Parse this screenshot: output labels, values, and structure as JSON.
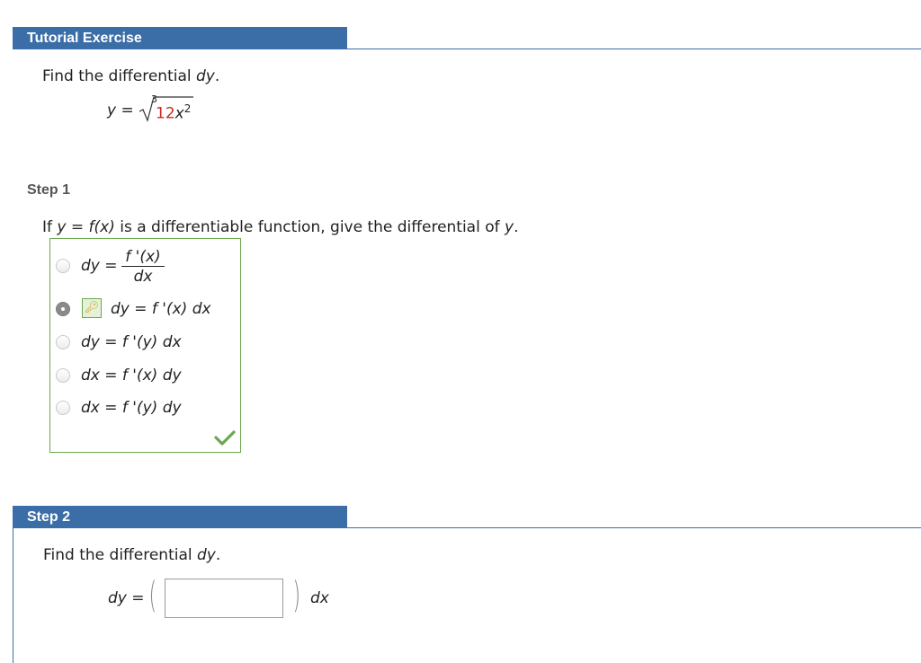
{
  "header": {
    "title": "Tutorial Exercise"
  },
  "problem": {
    "prompt_text": "Find the differential ",
    "prompt_var": "dy",
    "prompt_end": ".",
    "eq_lhs": "y =",
    "root_index": "3",
    "radicand_coef": "12",
    "radicand_var": "x",
    "radicand_exp": "2"
  },
  "step1": {
    "label": "Step 1",
    "question_pre": "If ",
    "question_eq": "y = f(x)",
    "question_mid": " is a differentiable function, give the differential of ",
    "question_var": "y",
    "question_end": ".",
    "options": [
      {
        "lhs": "dy =",
        "numerator": "f '(x)",
        "denominator": "dx",
        "selected": false
      },
      {
        "text": "dy = f '(x) dx",
        "selected": true
      },
      {
        "text": "dy = f '(y) dx",
        "selected": false
      },
      {
        "text": "dx = f '(x) dy",
        "selected": false
      },
      {
        "text": "dx = f '(y) dy",
        "selected": false
      }
    ],
    "status": "correct"
  },
  "step2": {
    "label": "Step 2",
    "prompt_text": "Find the differential ",
    "prompt_var": "dy",
    "prompt_end": ".",
    "eq_lhs": "dy =",
    "eq_rhs": "dx",
    "input_value": ""
  },
  "colors": {
    "header_blue": "#3b6ea7",
    "correct_green": "#6aa84f",
    "highlight_red": "#d0281e"
  }
}
